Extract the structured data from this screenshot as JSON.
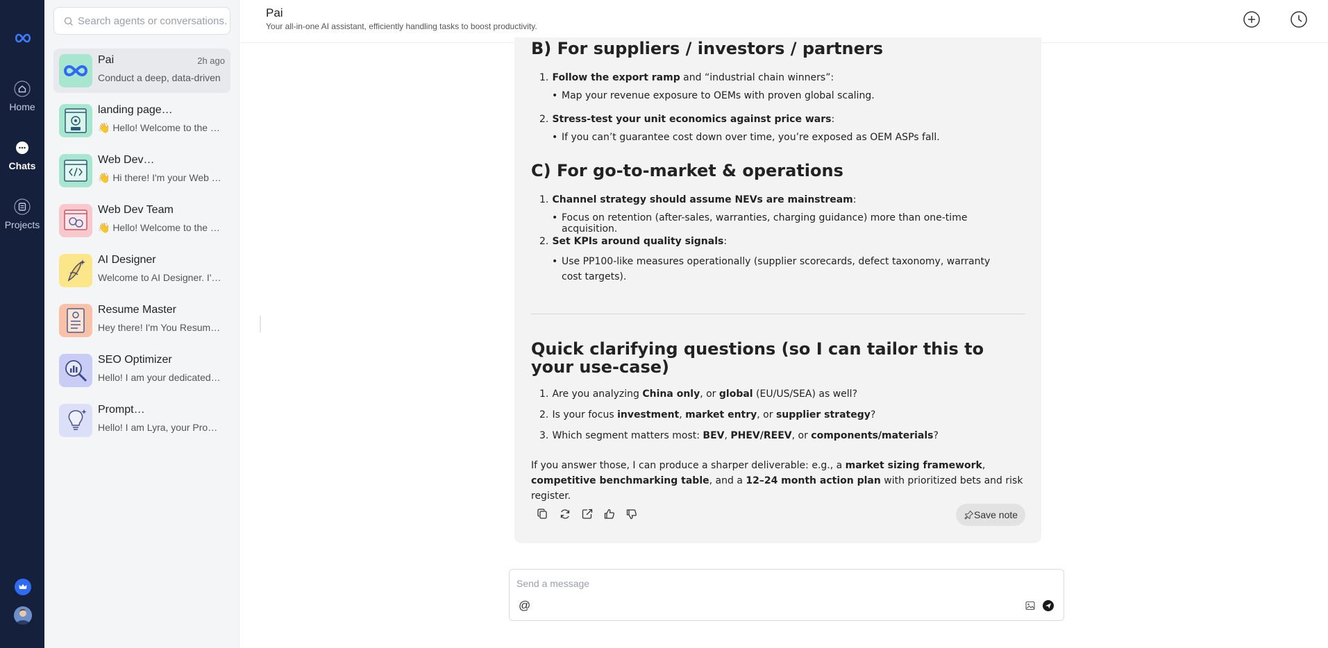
{
  "rail": {
    "items": [
      {
        "label": "Home",
        "icon": "home-icon"
      },
      {
        "label": "Chats",
        "icon": "chat-bubble-icon"
      },
      {
        "label": "Projects",
        "icon": "document-icon"
      }
    ]
  },
  "search": {
    "placeholder": "Search agents or conversations..."
  },
  "conversations": [
    {
      "name": "Pai",
      "time": "2h ago",
      "preview": "Conduct a deep, data-driven",
      "active": true
    },
    {
      "name": "landing page…",
      "time": "",
      "preview": "👋 Hello! Welcome to the …"
    },
    {
      "name": "Web Dev…",
      "time": "",
      "preview": "👋 Hi there! I'm your Web …"
    },
    {
      "name": "Web Dev Team",
      "time": "",
      "preview": "👋 Hello! Welcome to the …"
    },
    {
      "name": "AI Designer",
      "time": "",
      "preview": "Welcome to AI Designer. I'…"
    },
    {
      "name": "Resume Master",
      "time": "",
      "preview": "Hey there! I'm You Resum…"
    },
    {
      "name": "SEO Optimizer",
      "time": "",
      "preview": "Hello! I am your dedicated…"
    },
    {
      "name": "Prompt…",
      "time": "",
      "preview": "Hello! I am Lyra, your Pro…"
    }
  ],
  "header": {
    "title": "Pai",
    "subtitle": "Your all-in-one AI assistant, efficiently handling tasks to boost productivity."
  },
  "message": {
    "section_b": {
      "heading": "B) For suppliers / investors / partners",
      "items": [
        {
          "num": "1.",
          "bold": "Follow the export ramp",
          "rest": " and “industrial chain winners”:",
          "bullet": "Map your revenue exposure to OEMs with proven global scaling."
        },
        {
          "num": "2.",
          "bold": "Stress-test your unit economics against price wars",
          "rest": ":",
          "bullet": "If you can’t guarantee cost down over time, you’re exposed as OEM ASPs fall."
        }
      ]
    },
    "section_c": {
      "heading": "C) For go-to-market & operations",
      "items": [
        {
          "num": "1.",
          "bold": "Channel strategy should assume NEVs are mainstream",
          "rest": ":",
          "bullet": "Focus on retention (after-sales, warranties, charging guidance) more than one-time acquisition."
        },
        {
          "num": "2.",
          "bold": "Set KPIs around quality signals",
          "rest": ":",
          "bullet": "Use PP100-like measures operationally (supplier scorecards, defect taxonomy, warranty cost targets)."
        }
      ]
    },
    "questions": {
      "heading": "Quick clarifying questions (so I can tailor this to your use-case)",
      "q1": {
        "num": "1.",
        "a": "Are you analyzing ",
        "b1": "China only",
        "c": ", or ",
        "b2": "global",
        "d": " (EU/US/SEA) as well?"
      },
      "q2": {
        "num": "2.",
        "a": "Is your focus ",
        "b1": "investment",
        "c": ", ",
        "b2": "market entry",
        "d": ", or ",
        "b3": "supplier strategy",
        "e": "?"
      },
      "q3": {
        "num": "3.",
        "a": "Which segment matters most: ",
        "b1": "BEV",
        "c": ", ",
        "b2": "PHEV/REEV",
        "d": ", or ",
        "b3": "components/materials",
        "e": "?"
      }
    },
    "closing": {
      "a": "If you answer those, I can produce a sharper deliverable: e.g., a ",
      "b1": "market sizing framework",
      "c": ", ",
      "b2": "competitive benchmarking table",
      "d": ", and a ",
      "b3": "12–24 month action plan",
      "e": " with prioritized bets and risk register."
    },
    "save_note": "Save note"
  },
  "composer": {
    "placeholder": "Send a message",
    "at": "@"
  },
  "colors": {
    "rail_bg": "#15203d",
    "accent": "#2f6bf2",
    "bubble_bg": "#f3f3f3"
  }
}
